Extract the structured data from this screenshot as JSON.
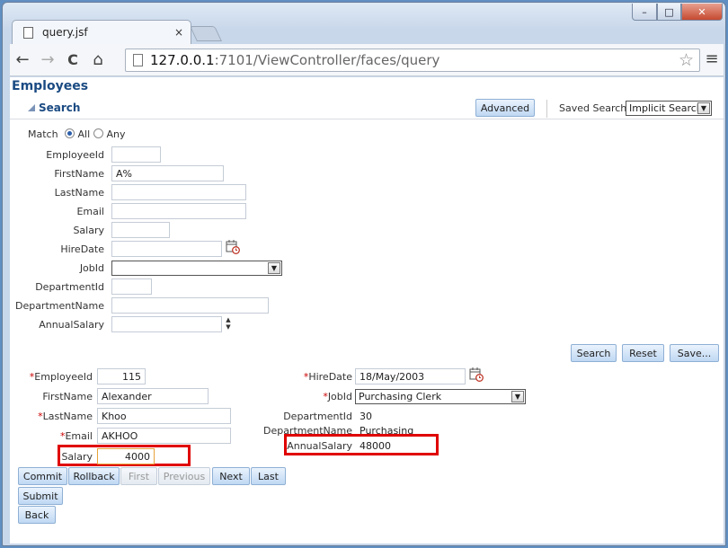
{
  "browser": {
    "tab_title": "query.jsf",
    "tab_close": "×",
    "url_host": "127.0.0.1",
    "url_path": ":7101/ViewController/faces/query",
    "window_controls": {
      "minimize": "–",
      "maximize": "□",
      "close": "✕"
    },
    "nav": {
      "back": "←",
      "forward": "→",
      "reload": "C",
      "home": "⌂",
      "menu": "≡",
      "star": "☆"
    }
  },
  "page": {
    "title": "Employees",
    "search": {
      "header": "Search",
      "advanced_label": "Advanced",
      "saved_search_label": "Saved Search",
      "saved_search_value": "Implicit Search",
      "match_label": "Match",
      "match_all": "All",
      "match_any": "Any",
      "fields": [
        {
          "label": "EmployeeId",
          "value": ""
        },
        {
          "label": "FirstName",
          "value": "A%"
        },
        {
          "label": "LastName",
          "value": ""
        },
        {
          "label": "Email",
          "value": ""
        },
        {
          "label": "Salary",
          "value": ""
        },
        {
          "label": "HireDate",
          "value": ""
        },
        {
          "label": "JobId",
          "value": ""
        },
        {
          "label": "DepartmentId",
          "value": ""
        },
        {
          "label": "DepartmentName",
          "value": ""
        },
        {
          "label": "AnnualSalary",
          "value": ""
        }
      ],
      "buttons": {
        "search": "Search",
        "reset": "Reset",
        "save": "Save..."
      }
    },
    "form": {
      "required_marker": "*",
      "employee_id": {
        "label": "EmployeeId",
        "value": "115"
      },
      "first_name": {
        "label": "FirstName",
        "value": "Alexander"
      },
      "last_name": {
        "label": "LastName",
        "value": "Khoo"
      },
      "email": {
        "label": "Email",
        "value": "AKHOO"
      },
      "salary": {
        "label": "Salary",
        "value": "4000"
      },
      "hire_date": {
        "label": "HireDate",
        "value": "18/May/2003"
      },
      "job_id": {
        "label": "JobId",
        "value": "Purchasing Clerk"
      },
      "department_id": {
        "label": "DepartmentId",
        "value": "30"
      },
      "department_name": {
        "label": "DepartmentName",
        "value": "Purchasing"
      },
      "annual_salary": {
        "label": "AnnualSalary",
        "value": "48000"
      }
    },
    "actions": {
      "commit": "Commit",
      "rollback": "Rollback",
      "first": "First",
      "previous": "Previous",
      "next": "Next",
      "last": "Last",
      "submit": "Submit",
      "back": "Back"
    }
  },
  "colors": {
    "accent": "#1a4a82",
    "highlight": "#e00000",
    "button_border": "#8fb0d5"
  }
}
